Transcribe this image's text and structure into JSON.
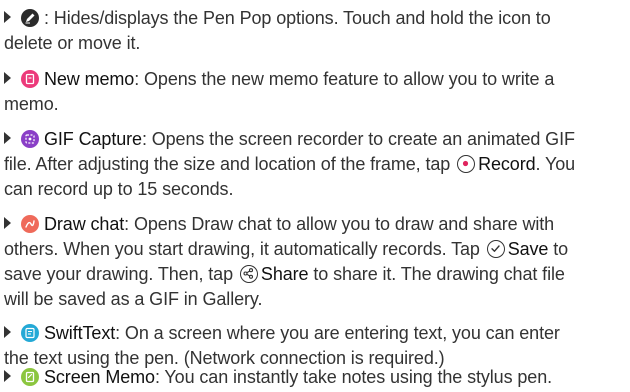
{
  "items": [
    {
      "icon": "pen-pop-icon",
      "lines": [
        {
          "title": "",
          "text": ": Hides/displays the Pen Pop options. Touch and hold the icon to"
        },
        {
          "text": "delete or move it."
        }
      ]
    },
    {
      "icon": "new-memo-icon",
      "lines": [
        {
          "title": "New memo",
          "text": ": Opens the new memo feature to allow you to write a"
        },
        {
          "text": "memo."
        }
      ]
    },
    {
      "icon": "gif-capture-icon",
      "lines": [
        {
          "title": "GIF Capture",
          "text": ": Opens the screen recorder to create an animated GIF"
        },
        {
          "text": "file. After adjusting the size and location of the frame, tap",
          "action": "Record",
          "after": ". You"
        },
        {
          "text": "can record up to 15 seconds."
        }
      ]
    },
    {
      "icon": "draw-chat-icon",
      "lines": [
        {
          "title": "Draw chat",
          "text": ": Opens Draw chat to allow you to draw and share with"
        },
        {
          "text": "others. When you start drawing, it automatically records. Tap",
          "action": "Save",
          "after": " to"
        },
        {
          "text": "save your drawing. Then, tap",
          "action": "Share",
          "after": " to share it. The drawing chat file"
        },
        {
          "text": "will be saved as a GIF in Gallery."
        }
      ]
    },
    {
      "icon": "swift-text-icon",
      "lines": [
        {
          "title": "SwiftText",
          "text": ": On a screen where you are entering text, you can enter"
        },
        {
          "text": "the text using the pen. (Network connection is required.)"
        }
      ]
    },
    {
      "icon": "screen-memo-icon",
      "lines": [
        {
          "title": "Screen Memo",
          "text": ": You can instantly take notes using the stylus pen."
        }
      ]
    }
  ]
}
